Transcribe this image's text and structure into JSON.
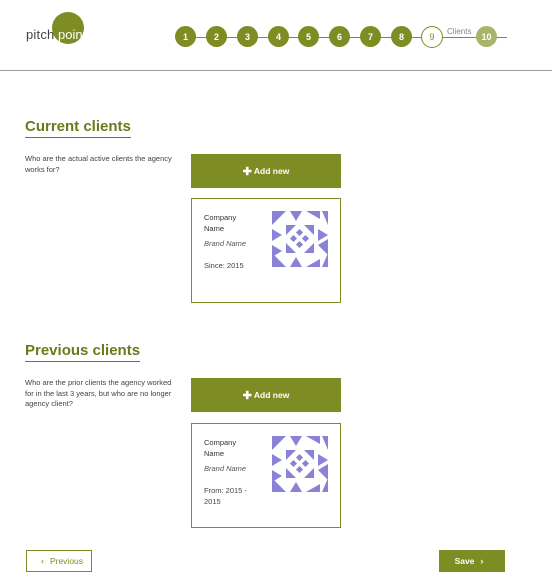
{
  "logo": {
    "text_left": "pitch",
    "text_right": "point"
  },
  "steps": {
    "items": [
      "1",
      "2",
      "3",
      "4",
      "5",
      "6",
      "7",
      "8",
      "9",
      "10"
    ],
    "current_label": "Clients"
  },
  "current_clients": {
    "title": "Current clients",
    "description": "Who are the actual active clients the agency works for?",
    "add_label": "Add new",
    "card": {
      "company": "Company Name",
      "brand": "Brand Name",
      "period": "Since: 2015"
    }
  },
  "previous_clients": {
    "title": "Previous clients",
    "description": "Who are the prior clients the agency worked for in the last 3 years, but who are no longer agency client?",
    "add_label": "Add new",
    "card": {
      "company": "Company Name",
      "brand": "Brand Name",
      "period": "From: 2015 - 2015"
    }
  },
  "footer": {
    "previous_label": "Previous",
    "save_label": "Save"
  },
  "colors": {
    "accent": "#7d8c23",
    "logo_pattern": "#8a82d6"
  }
}
